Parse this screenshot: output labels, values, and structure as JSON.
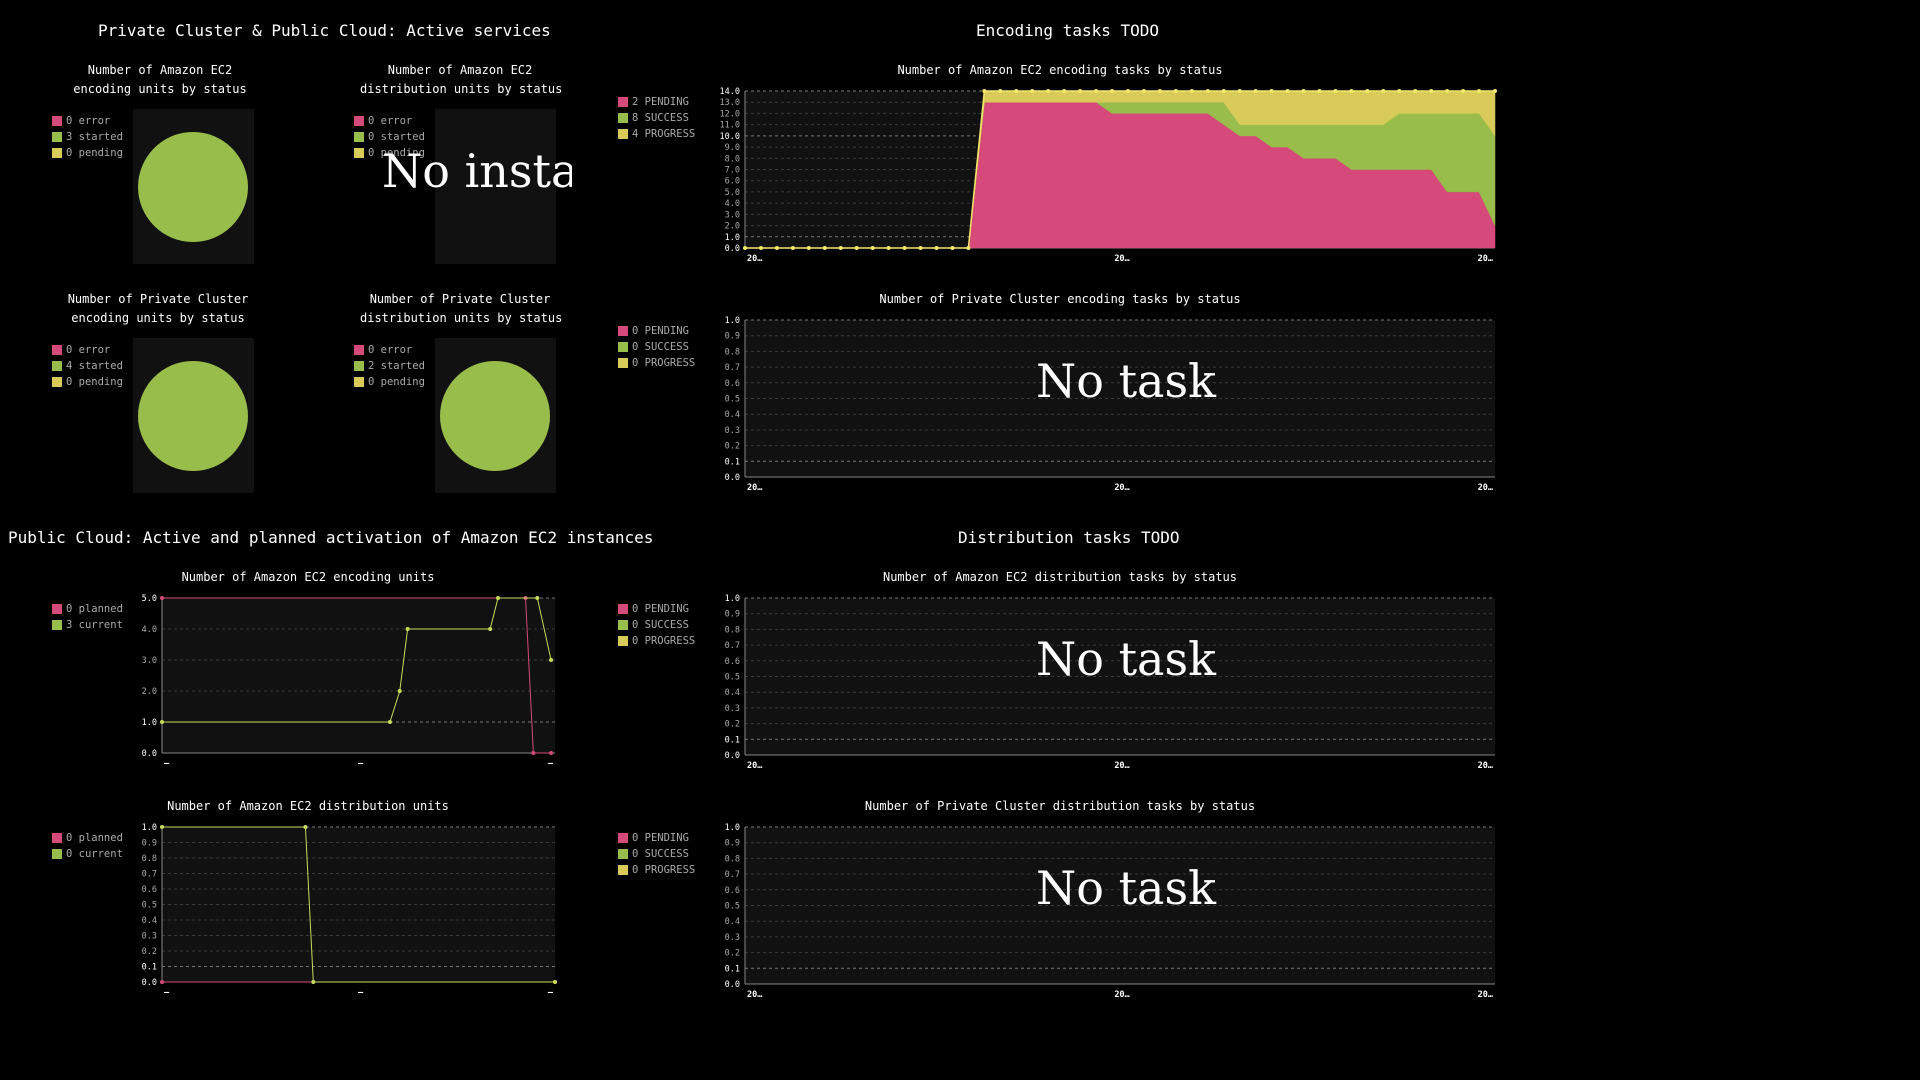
{
  "colors": {
    "pending": "#d64a7b",
    "success": "#98bd4a",
    "progress": "#d9cb5a",
    "error": "#d64a7b",
    "started": "#98bd4a",
    "planned": "#d64a7b",
    "current": "#98bd4a",
    "panel": "#111111",
    "grid": "#555555"
  },
  "sections": {
    "active_services": "Private Cluster & Public Cloud: Active services",
    "encoding_todo": "Encoding tasks TODO",
    "ec2_activation": "Public Cloud: Active and planned activation of Amazon EC2 instances",
    "distribution_todo": "Distribution tasks TODO"
  },
  "pies": {
    "ec2_encoding": {
      "title1": "Number of Amazon EC2",
      "title2": "encoding units by status",
      "legend": [
        "0 error",
        "3 started",
        "0 pending"
      ]
    },
    "ec2_distribution": {
      "title1": "Number of Amazon EC2",
      "title2": "distribution units by status",
      "legend": [
        "0 error",
        "0 started",
        "0 pending"
      ],
      "message": "No instance"
    },
    "pc_encoding": {
      "title1": "Number of Private Cluster",
      "title2": "encoding units by status",
      "legend": [
        "0 error",
        "4 started",
        "0 pending"
      ]
    },
    "pc_distribution": {
      "title1": "Number of Private Cluster",
      "title2": "distribution units by status",
      "legend": [
        "0 error",
        "2 started",
        "0 pending"
      ]
    }
  },
  "ec2_enc_tasks": {
    "title": "Number of Amazon EC2 encoding tasks by status",
    "legend": [
      "2 PENDING",
      "8 SUCCESS",
      "4 PROGRESS"
    ],
    "x_labels": [
      "20…",
      "20…",
      "20…"
    ]
  },
  "pc_enc_tasks": {
    "title": "Number of Private Cluster encoding tasks by status",
    "legend": [
      "0 PENDING",
      "0 SUCCESS",
      "0 PROGRESS"
    ],
    "message": "No task",
    "x_labels": [
      "20…",
      "20…",
      "20…"
    ]
  },
  "ec2_dist_tasks": {
    "title": "Number of Amazon EC2 distribution tasks by status",
    "legend": [
      "0 PENDING",
      "0 SUCCESS",
      "0 PROGRESS"
    ],
    "message": "No task",
    "x_labels": [
      "20…",
      "20…",
      "20…"
    ]
  },
  "pc_dist_tasks": {
    "title": "Number of Private Cluster distribution tasks by status",
    "legend": [
      "0 PENDING",
      "0 SUCCESS",
      "0 PROGRESS"
    ],
    "message": "No task",
    "x_labels": [
      "20…",
      "20…",
      "20…"
    ]
  },
  "ec2_enc_units": {
    "title": "Number of Amazon EC2 encoding units",
    "legend": [
      "0 planned",
      "3 current"
    ],
    "x_labels": [
      "–",
      "–",
      "–"
    ]
  },
  "ec2_dist_units": {
    "title": "Number of Amazon EC2 distribution units",
    "legend": [
      "0 planned",
      "0 current"
    ],
    "x_labels": [
      "–",
      "–",
      "–"
    ]
  },
  "chart_data": [
    {
      "id": "ec2_enc_tasks",
      "type": "area",
      "title": "Number of Amazon EC2 encoding tasks by status",
      "ylim": [
        0,
        14
      ],
      "y_ticks": [
        "0.0",
        "1.0",
        "2.0",
        "3.0",
        "4.0",
        "5.0",
        "6.0",
        "7.0",
        "8.0",
        "9.0",
        "10.0",
        "11.0",
        "12.0",
        "13.0",
        "14.0"
      ],
      "series": [
        {
          "name": "PENDING",
          "values": [
            0,
            0,
            0,
            0,
            0,
            0,
            0,
            0,
            0,
            0,
            0,
            0,
            0,
            0,
            0,
            13,
            13,
            13,
            13,
            13,
            13,
            13,
            13,
            12,
            12,
            12,
            12,
            12,
            12,
            12,
            11,
            10,
            10,
            9,
            9,
            8,
            8,
            8,
            7,
            7,
            7,
            7,
            7,
            7,
            5,
            5,
            5,
            2
          ]
        },
        {
          "name": "SUCCESS",
          "values": [
            0,
            0,
            0,
            0,
            0,
            0,
            0,
            0,
            0,
            0,
            0,
            0,
            0,
            0,
            0,
            0,
            0,
            0,
            0,
            0,
            0,
            0,
            0,
            1,
            1,
            1,
            1,
            1,
            1,
            1,
            2,
            1,
            1,
            2,
            2,
            3,
            3,
            3,
            4,
            4,
            4,
            5,
            5,
            5,
            7,
            7,
            7,
            8
          ]
        },
        {
          "name": "PROGRESS",
          "values": [
            0,
            0,
            0,
            0,
            0,
            0,
            0,
            0,
            0,
            0,
            0,
            0,
            0,
            0,
            0,
            1,
            1,
            1,
            1,
            1,
            1,
            1,
            1,
            1,
            1,
            1,
            1,
            1,
            1,
            1,
            1,
            3,
            3,
            3,
            3,
            3,
            3,
            3,
            3,
            3,
            3,
            2,
            2,
            2,
            2,
            2,
            2,
            4
          ]
        }
      ]
    },
    {
      "id": "pc_enc_tasks",
      "type": "area",
      "ylim": [
        0,
        1
      ],
      "y_ticks": [
        "0.0",
        "0.1",
        "0.2",
        "0.3",
        "0.4",
        "0.5",
        "0.6",
        "0.7",
        "0.8",
        "0.9",
        "1.0"
      ],
      "series": []
    },
    {
      "id": "ec2_dist_tasks",
      "type": "area",
      "ylim": [
        0,
        1
      ],
      "y_ticks": [
        "0.0",
        "0.1",
        "0.2",
        "0.3",
        "0.4",
        "0.5",
        "0.6",
        "0.7",
        "0.8",
        "0.9",
        "1.0"
      ],
      "series": []
    },
    {
      "id": "pc_dist_tasks",
      "type": "area",
      "ylim": [
        0,
        1
      ],
      "y_ticks": [
        "0.0",
        "0.1",
        "0.2",
        "0.3",
        "0.4",
        "0.5",
        "0.6",
        "0.7",
        "0.8",
        "0.9",
        "1.0"
      ],
      "series": []
    },
    {
      "id": "ec2_enc_units",
      "type": "line",
      "title": "Number of Amazon EC2 encoding units",
      "ylim": [
        0,
        5
      ],
      "y_ticks": [
        "0.0",
        "1.0",
        "2.0",
        "3.0",
        "4.0",
        "5.0"
      ],
      "series": [
        {
          "name": "planned",
          "x": [
            0,
            0.925,
            0.945,
            0.99
          ],
          "values": [
            5,
            5,
            0,
            0
          ]
        },
        {
          "name": "current",
          "x": [
            0,
            0.58,
            0.605,
            0.625,
            0.835,
            0.855,
            0.955,
            0.99
          ],
          "values": [
            1,
            1,
            2,
            4,
            4,
            5,
            5,
            3
          ]
        }
      ]
    },
    {
      "id": "ec2_dist_units",
      "type": "line",
      "title": "Number of Amazon EC2 distribution units",
      "ylim": [
        0,
        1
      ],
      "y_ticks": [
        "0.0",
        "0.1",
        "0.2",
        "0.3",
        "0.4",
        "0.5",
        "0.6",
        "0.7",
        "0.8",
        "0.9",
        "1.0"
      ],
      "series": [
        {
          "name": "planned",
          "x": [
            0,
            1
          ],
          "values": [
            0,
            0
          ]
        },
        {
          "name": "current",
          "x": [
            0,
            0.365,
            0.385,
            1
          ],
          "values": [
            1,
            1,
            0,
            0
          ]
        }
      ]
    }
  ]
}
